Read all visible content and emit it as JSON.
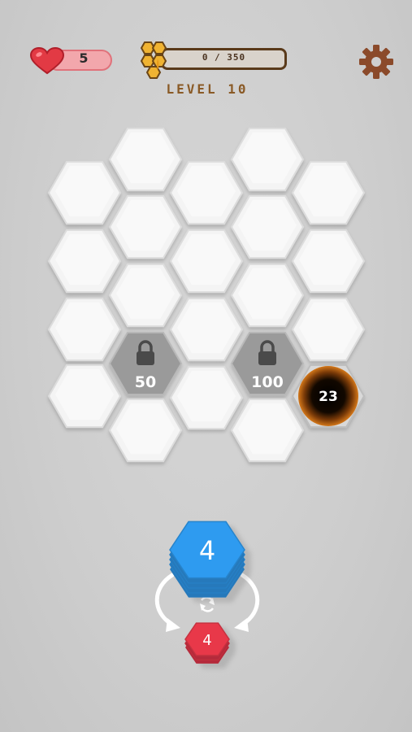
{
  "hud": {
    "lives_count": "5",
    "progress_text": "0 / 350",
    "progress_fraction": 0,
    "level_label": "LEVEL 10"
  },
  "board": {
    "locked_cells": [
      {
        "cost": "50"
      },
      {
        "cost": "100"
      }
    ],
    "black_hole": {
      "count": "23"
    }
  },
  "tray": {
    "main_stack": {
      "value": "4",
      "color": "#2f9bf0"
    },
    "next_stack": {
      "value": "4",
      "color": "#e8394a"
    }
  },
  "icons": [
    "heart-icon",
    "honeycomb-icon",
    "gear-icon",
    "lock-icon",
    "swap-icon"
  ],
  "colors": {
    "tile": "#f4f4f4",
    "locked_tile": "#9a9a9a",
    "progress_fill": "#e8a62a",
    "level_text": "#8a5a26",
    "gear": "#8b4a2a"
  }
}
